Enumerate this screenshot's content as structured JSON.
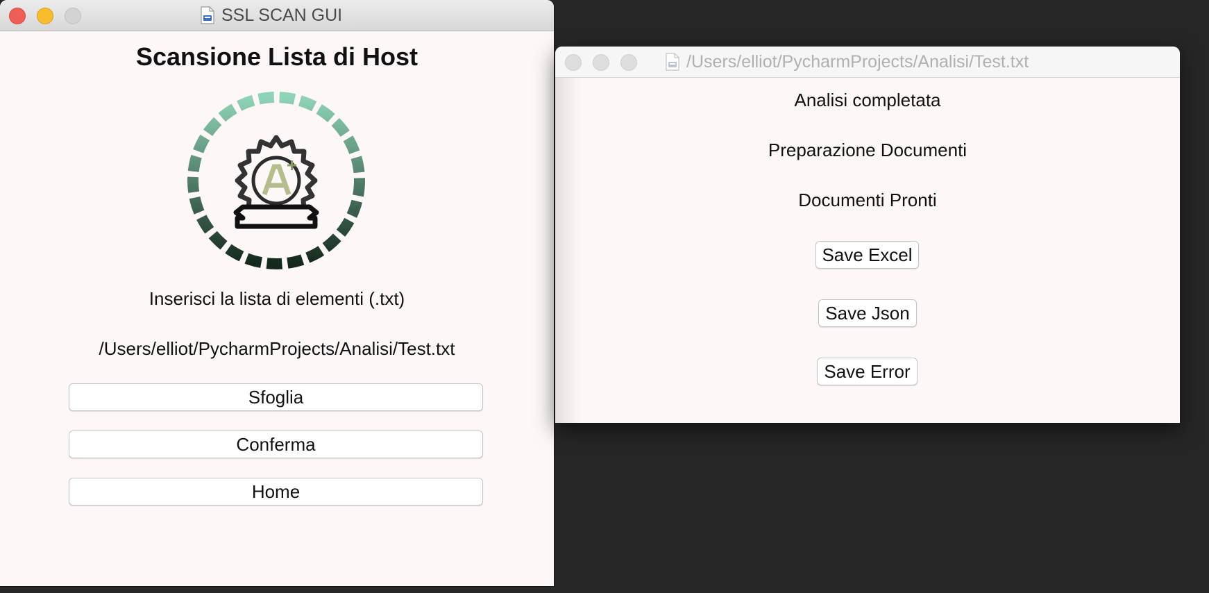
{
  "main_window": {
    "title": "SSL SCAN GUI",
    "heading": "Scansione Lista di Host",
    "prompt": "Inserisci la lista di elementi (.txt)",
    "selected_path": "/Users/elliot/PycharmProjects/Analisi/Test.txt",
    "buttons": {
      "browse": "Sfoglia",
      "confirm": "Conferma",
      "home": "Home"
    },
    "logo_icon": "ssl-badge-logo-icon",
    "logo_colors": {
      "ring_top": "#8fd4b7",
      "ring_bottom": "#14281c"
    }
  },
  "result_window": {
    "title": "/Users/elliot/PycharmProjects/Analisi/Test.txt",
    "status_lines": [
      "Analisi completata",
      "Preparazione Documenti",
      "Documenti Pronti"
    ],
    "buttons": {
      "save_excel": "Save Excel",
      "save_json": "Save Json",
      "save_error": "Save Error"
    }
  }
}
